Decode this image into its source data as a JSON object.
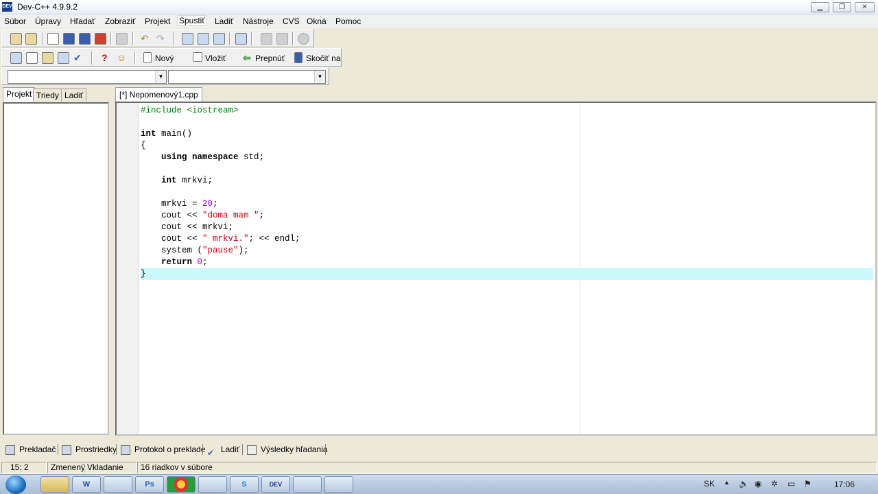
{
  "window": {
    "title": "Dev-C++ 4.9.9.2",
    "app_icon_text": "DEV"
  },
  "menu": [
    "Súbor",
    "Úpravy",
    "Hľadať",
    "Zobraziť",
    "Projekt",
    "Spustiť",
    "Ladiť",
    "Nástroje",
    "CVS",
    "Okná",
    "Pomoc"
  ],
  "toolbar2": {
    "new_label": "Nový",
    "insert_label": "Vložiť",
    "toggle_label": "Prepnúť",
    "goto_label": "Skočiť na"
  },
  "combos": {
    "class_value": "",
    "member_value": ""
  },
  "left_tabs": [
    "Projekt",
    "Triedy",
    "Ladiť"
  ],
  "editor": {
    "tab_label": "[*] Nepomenový1.cpp"
  },
  "bottom_tabs": [
    "Prekladač",
    "Prostriedky",
    "Protokol o preklade",
    "Ladiť",
    "Výsledky hľadania"
  ],
  "status": {
    "position": "15: 2",
    "modified": "Zmenený",
    "mode": "Vkladanie",
    "lines_info": "16 riadkov v súbore"
  },
  "taskbar": {
    "language": "SK",
    "time": "17:06",
    "apps": [
      "explorer",
      "word",
      "network",
      "photoshop",
      "chrome",
      "messenger",
      "skype",
      "dev-cpp",
      "image-viewer",
      "media-tool"
    ],
    "labels": {
      "word": "W",
      "photoshop": "Ps",
      "skype": "S",
      "dev-cpp": "DEV"
    }
  }
}
